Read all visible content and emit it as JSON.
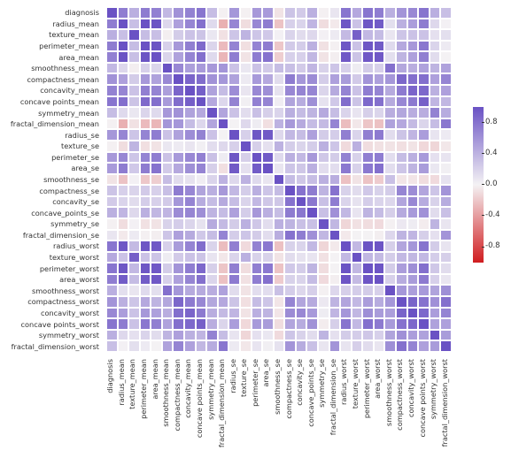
{
  "chart_data": {
    "type": "heatmap",
    "title": "",
    "xlabel": "",
    "ylabel": "",
    "colorscale": {
      "min": -1.0,
      "max": 1.0,
      "low_color": "#d01c1f",
      "mid_color": "#f4f2f4",
      "high_color": "#6a52c4"
    },
    "colorbar_ticks": [
      0.8,
      0.4,
      0.0,
      -0.4,
      -0.8
    ],
    "labels": [
      "diagnosis",
      "radius_mean",
      "texture_mean",
      "perimeter_mean",
      "area_mean",
      "smoothness_mean",
      "compactness_mean",
      "concavity_mean",
      "concave points_mean",
      "symmetry_mean",
      "fractal_dimension_mean",
      "radius_se",
      "texture_se",
      "perimeter_se",
      "area_se",
      "smoothness_se",
      "compactness_se",
      "concavity_se",
      "concave_points_se",
      "symmetry_se",
      "fractal_dimension_se",
      "radius_worst",
      "texture_worst",
      "perimeter_worst",
      "area_worst",
      "smoothness_worst",
      "compactness_worst",
      "concavity_worst",
      "concave points_worst",
      "symmetry_worst",
      "fractal_dimension_worst"
    ],
    "matrix": [
      [
        1.0,
        0.73,
        0.42,
        0.74,
        0.71,
        0.36,
        0.6,
        0.7,
        0.78,
        0.33,
        -0.01,
        0.57,
        -0.01,
        0.56,
        0.55,
        -0.07,
        0.29,
        0.25,
        0.41,
        -0.01,
        0.08,
        0.78,
        0.46,
        0.78,
        0.73,
        0.42,
        0.59,
        0.66,
        0.79,
        0.42,
        0.32
      ],
      [
        0.73,
        1.0,
        0.32,
        1.0,
        0.99,
        0.17,
        0.51,
        0.68,
        0.82,
        0.15,
        -0.31,
        0.68,
        -0.1,
        0.67,
        0.74,
        -0.22,
        0.21,
        0.19,
        0.38,
        -0.1,
        -0.04,
        0.97,
        0.3,
        0.97,
        0.94,
        0.12,
        0.41,
        0.53,
        0.74,
        0.16,
        0.01
      ],
      [
        0.42,
        0.32,
        1.0,
        0.33,
        0.32,
        -0.02,
        0.24,
        0.3,
        0.29,
        0.07,
        -0.08,
        0.28,
        0.39,
        0.28,
        0.26,
        0.01,
        0.19,
        0.14,
        0.16,
        0.01,
        0.05,
        0.35,
        0.91,
        0.36,
        0.34,
        0.08,
        0.28,
        0.3,
        0.3,
        0.11,
        0.12
      ],
      [
        0.74,
        1.0,
        0.33,
        1.0,
        0.99,
        0.21,
        0.56,
        0.72,
        0.85,
        0.18,
        -0.26,
        0.69,
        -0.09,
        0.69,
        0.74,
        -0.2,
        0.25,
        0.23,
        0.41,
        -0.08,
        -0.01,
        0.97,
        0.3,
        0.97,
        0.94,
        0.15,
        0.46,
        0.56,
        0.77,
        0.19,
        0.05
      ],
      [
        0.71,
        0.99,
        0.32,
        0.99,
        1.0,
        0.18,
        0.5,
        0.69,
        0.82,
        0.15,
        -0.28,
        0.73,
        -0.07,
        0.73,
        0.8,
        -0.17,
        0.21,
        0.21,
        0.37,
        -0.07,
        -0.02,
        0.96,
        0.29,
        0.96,
        0.96,
        0.12,
        0.39,
        0.51,
        0.72,
        0.14,
        0.0
      ],
      [
        0.36,
        0.17,
        -0.02,
        0.21,
        0.18,
        1.0,
        0.66,
        0.52,
        0.55,
        0.56,
        0.58,
        0.3,
        0.07,
        0.3,
        0.25,
        0.33,
        0.32,
        0.25,
        0.38,
        0.2,
        0.28,
        0.21,
        0.04,
        0.24,
        0.21,
        0.81,
        0.47,
        0.43,
        0.5,
        0.39,
        0.5
      ],
      [
        0.6,
        0.51,
        0.24,
        0.56,
        0.5,
        0.66,
        1.0,
        0.88,
        0.83,
        0.6,
        0.57,
        0.5,
        0.05,
        0.55,
        0.46,
        0.14,
        0.74,
        0.57,
        0.64,
        0.23,
        0.51,
        0.54,
        0.25,
        0.59,
        0.51,
        0.57,
        0.87,
        0.82,
        0.82,
        0.51,
        0.69
      ],
      [
        0.7,
        0.68,
        0.3,
        0.72,
        0.69,
        0.52,
        0.88,
        1.0,
        0.92,
        0.5,
        0.34,
        0.63,
        0.08,
        0.66,
        0.62,
        0.1,
        0.67,
        0.69,
        0.68,
        0.18,
        0.45,
        0.69,
        0.3,
        0.73,
        0.68,
        0.45,
        0.75,
        0.88,
        0.86,
        0.41,
        0.51
      ],
      [
        0.78,
        0.82,
        0.29,
        0.85,
        0.82,
        0.55,
        0.83,
        0.92,
        1.0,
        0.46,
        0.17,
        0.7,
        0.02,
        0.71,
        0.69,
        0.03,
        0.49,
        0.44,
        0.62,
        0.1,
        0.26,
        0.83,
        0.29,
        0.86,
        0.81,
        0.45,
        0.67,
        0.75,
        0.91,
        0.38,
        0.37
      ],
      [
        0.33,
        0.15,
        0.07,
        0.18,
        0.15,
        0.56,
        0.6,
        0.5,
        0.46,
        1.0,
        0.48,
        0.3,
        0.13,
        0.31,
        0.22,
        0.19,
        0.42,
        0.34,
        0.39,
        0.45,
        0.33,
        0.19,
        0.09,
        0.22,
        0.18,
        0.43,
        0.47,
        0.43,
        0.43,
        0.7,
        0.44
      ],
      [
        -0.01,
        -0.31,
        -0.08,
        -0.26,
        -0.28,
        0.58,
        0.57,
        0.34,
        0.17,
        0.48,
        1.0,
        0.0,
        0.16,
        0.04,
        -0.09,
        0.4,
        0.56,
        0.45,
        0.34,
        0.35,
        0.69,
        -0.25,
        -0.05,
        -0.21,
        -0.23,
        0.5,
        0.46,
        0.35,
        0.18,
        0.33,
        0.77
      ],
      [
        0.57,
        0.68,
        0.28,
        0.69,
        0.73,
        0.3,
        0.5,
        0.63,
        0.7,
        0.3,
        0.0,
        1.0,
        0.21,
        0.97,
        0.95,
        0.16,
        0.36,
        0.33,
        0.51,
        0.24,
        0.23,
        0.72,
        0.19,
        0.72,
        0.75,
        0.14,
        0.29,
        0.38,
        0.53,
        0.09,
        0.05
      ],
      [
        -0.01,
        -0.1,
        0.39,
        -0.09,
        -0.07,
        0.07,
        0.05,
        0.08,
        0.02,
        0.13,
        0.16,
        0.21,
        1.0,
        0.22,
        0.11,
        0.4,
        0.23,
        0.19,
        0.23,
        0.41,
        0.28,
        -0.11,
        0.41,
        -0.1,
        -0.08,
        -0.07,
        -0.09,
        -0.07,
        -0.12,
        -0.13,
        -0.05
      ],
      [
        0.56,
        0.67,
        0.28,
        0.69,
        0.73,
        0.3,
        0.55,
        0.66,
        0.71,
        0.31,
        0.04,
        0.97,
        0.22,
        1.0,
        0.94,
        0.15,
        0.42,
        0.36,
        0.56,
        0.27,
        0.24,
        0.7,
        0.2,
        0.72,
        0.73,
        0.13,
        0.34,
        0.42,
        0.55,
        0.11,
        0.09
      ],
      [
        0.55,
        0.74,
        0.26,
        0.74,
        0.8,
        0.25,
        0.46,
        0.62,
        0.69,
        0.22,
        -0.09,
        0.95,
        0.11,
        0.94,
        1.0,
        0.08,
        0.28,
        0.27,
        0.42,
        0.13,
        0.13,
        0.76,
        0.2,
        0.76,
        0.81,
        0.13,
        0.28,
        0.39,
        0.54,
        0.07,
        0.02
      ],
      [
        -0.07,
        -0.22,
        0.01,
        -0.2,
        -0.17,
        0.33,
        0.14,
        0.1,
        0.03,
        0.19,
        0.4,
        0.16,
        0.4,
        0.15,
        0.08,
        1.0,
        0.34,
        0.27,
        0.33,
        0.41,
        0.43,
        -0.23,
        -0.07,
        -0.22,
        -0.18,
        0.31,
        -0.06,
        -0.06,
        -0.1,
        -0.11,
        0.1
      ],
      [
        0.29,
        0.21,
        0.19,
        0.25,
        0.21,
        0.32,
        0.74,
        0.67,
        0.49,
        0.42,
        0.56,
        0.36,
        0.23,
        0.42,
        0.28,
        0.34,
        1.0,
        0.8,
        0.74,
        0.39,
        0.8,
        0.2,
        0.14,
        0.26,
        0.2,
        0.23,
        0.68,
        0.64,
        0.48,
        0.28,
        0.59
      ],
      [
        0.25,
        0.19,
        0.14,
        0.23,
        0.21,
        0.25,
        0.57,
        0.69,
        0.44,
        0.34,
        0.45,
        0.33,
        0.19,
        0.36,
        0.27,
        0.27,
        0.8,
        1.0,
        0.77,
        0.31,
        0.73,
        0.19,
        0.1,
        0.23,
        0.19,
        0.17,
        0.48,
        0.66,
        0.44,
        0.2,
        0.44
      ],
      [
        0.41,
        0.38,
        0.16,
        0.41,
        0.37,
        0.38,
        0.64,
        0.68,
        0.62,
        0.39,
        0.34,
        0.51,
        0.23,
        0.56,
        0.42,
        0.33,
        0.74,
        0.77,
        1.0,
        0.31,
        0.61,
        0.36,
        0.09,
        0.39,
        0.34,
        0.22,
        0.45,
        0.55,
        0.6,
        0.14,
        0.31
      ],
      [
        -0.01,
        -0.1,
        0.01,
        -0.08,
        -0.07,
        0.2,
        0.23,
        0.18,
        0.1,
        0.45,
        0.35,
        0.24,
        0.41,
        0.27,
        0.13,
        0.41,
        0.39,
        0.31,
        0.31,
        1.0,
        0.37,
        -0.13,
        -0.08,
        -0.1,
        -0.11,
        -0.01,
        0.06,
        0.04,
        -0.03,
        0.39,
        0.08
      ],
      [
        0.08,
        -0.04,
        0.05,
        -0.01,
        -0.02,
        0.28,
        0.51,
        0.45,
        0.26,
        0.33,
        0.69,
        0.23,
        0.28,
        0.24,
        0.13,
        0.43,
        0.8,
        0.73,
        0.61,
        0.37,
        1.0,
        -0.04,
        -0.0,
        -0.0,
        -0.02,
        0.17,
        0.39,
        0.38,
        0.22,
        0.11,
        0.59
      ],
      [
        0.78,
        0.97,
        0.35,
        0.97,
        0.96,
        0.21,
        0.54,
        0.69,
        0.83,
        0.19,
        -0.25,
        0.72,
        -0.11,
        0.7,
        0.76,
        -0.23,
        0.2,
        0.19,
        0.36,
        -0.13,
        -0.04,
        1.0,
        0.36,
        0.99,
        0.98,
        0.22,
        0.48,
        0.57,
        0.79,
        0.24,
        0.09
      ],
      [
        0.46,
        0.3,
        0.91,
        0.3,
        0.29,
        0.04,
        0.25,
        0.3,
        0.29,
        0.09,
        -0.05,
        0.19,
        0.41,
        0.2,
        0.2,
        -0.07,
        0.14,
        0.1,
        0.09,
        -0.08,
        -0.0,
        0.36,
        1.0,
        0.37,
        0.35,
        0.23,
        0.36,
        0.37,
        0.36,
        0.23,
        0.22
      ],
      [
        0.78,
        0.97,
        0.36,
        0.97,
        0.96,
        0.24,
        0.59,
        0.73,
        0.86,
        0.22,
        -0.21,
        0.72,
        -0.1,
        0.72,
        0.76,
        -0.22,
        0.26,
        0.23,
        0.39,
        -0.1,
        -0.0,
        0.99,
        0.37,
        1.0,
        0.98,
        0.24,
        0.53,
        0.62,
        0.82,
        0.27,
        0.14
      ],
      [
        0.73,
        0.94,
        0.34,
        0.94,
        0.96,
        0.21,
        0.51,
        0.68,
        0.81,
        0.18,
        -0.23,
        0.75,
        -0.08,
        0.73,
        0.81,
        -0.18,
        0.2,
        0.19,
        0.34,
        -0.11,
        -0.02,
        0.98,
        0.35,
        0.98,
        1.0,
        0.21,
        0.44,
        0.54,
        0.75,
        0.21,
        0.08
      ],
      [
        0.42,
        0.12,
        0.08,
        0.15,
        0.12,
        0.81,
        0.57,
        0.45,
        0.45,
        0.43,
        0.5,
        0.14,
        -0.07,
        0.13,
        0.13,
        0.31,
        0.23,
        0.17,
        0.22,
        -0.01,
        0.17,
        0.22,
        0.23,
        0.24,
        0.21,
        1.0,
        0.57,
        0.52,
        0.55,
        0.49,
        0.62
      ],
      [
        0.59,
        0.41,
        0.28,
        0.46,
        0.39,
        0.47,
        0.87,
        0.75,
        0.67,
        0.47,
        0.46,
        0.29,
        -0.09,
        0.34,
        0.28,
        -0.06,
        0.68,
        0.48,
        0.45,
        0.06,
        0.39,
        0.48,
        0.36,
        0.53,
        0.44,
        0.57,
        1.0,
        0.89,
        0.8,
        0.61,
        0.81
      ],
      [
        0.66,
        0.53,
        0.3,
        0.56,
        0.51,
        0.43,
        0.82,
        0.88,
        0.75,
        0.43,
        0.35,
        0.38,
        -0.07,
        0.42,
        0.39,
        -0.06,
        0.64,
        0.66,
        0.55,
        0.04,
        0.38,
        0.57,
        0.37,
        0.62,
        0.54,
        0.52,
        0.89,
        1.0,
        0.86,
        0.53,
        0.69
      ],
      [
        0.79,
        0.74,
        0.3,
        0.77,
        0.72,
        0.5,
        0.82,
        0.86,
        0.91,
        0.43,
        0.18,
        0.53,
        -0.12,
        0.55,
        0.54,
        -0.1,
        0.48,
        0.44,
        0.6,
        -0.03,
        0.22,
        0.79,
        0.36,
        0.82,
        0.75,
        0.55,
        0.8,
        0.86,
        1.0,
        0.5,
        0.51
      ],
      [
        0.42,
        0.16,
        0.11,
        0.19,
        0.14,
        0.39,
        0.51,
        0.41,
        0.38,
        0.7,
        0.33,
        0.09,
        -0.13,
        0.11,
        0.07,
        -0.11,
        0.28,
        0.2,
        0.14,
        0.39,
        0.11,
        0.24,
        0.23,
        0.27,
        0.21,
        0.49,
        0.61,
        0.53,
        0.5,
        1.0,
        0.54
      ],
      [
        0.32,
        0.01,
        0.12,
        0.05,
        0.0,
        0.5,
        0.69,
        0.51,
        0.37,
        0.44,
        0.77,
        0.05,
        -0.05,
        0.09,
        0.02,
        0.1,
        0.59,
        0.44,
        0.31,
        0.08,
        0.59,
        0.09,
        0.22,
        0.14,
        0.08,
        0.62,
        0.81,
        0.69,
        0.51,
        0.54,
        1.0
      ]
    ]
  }
}
